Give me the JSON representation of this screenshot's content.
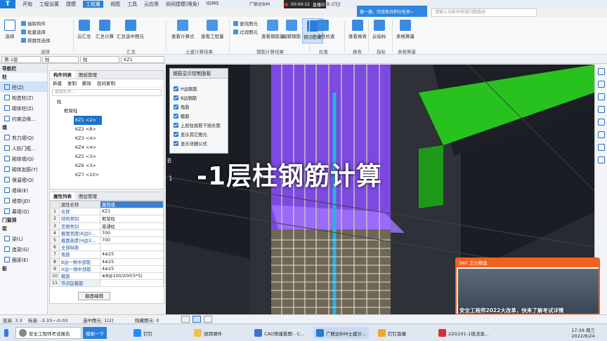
{
  "titlebar": {
    "logo": "T",
    "menus": [
      "开始",
      "工程设置",
      "建模",
      "工程量",
      "视图",
      "工具",
      "云应用",
      "协同建模(限免)",
      "IGMS"
    ],
    "active_menu": "工程量",
    "app_title": "广联达BIM",
    "file_path": ":\\商业.GTJ]",
    "rec_time": "00:04:12",
    "rec_status": "直播中",
    "notice": "搜一搜，完成每日积分任务~",
    "search_placeholder": "请输入功能名称或问题描述"
  },
  "ribbon": {
    "select": [
      "选择"
    ],
    "select_small": [
      "抽取构件",
      "批量选择",
      "按属性选择"
    ],
    "group_select": "选择",
    "summary": [
      "云汇总",
      "汇总计算",
      "汇总选中图元"
    ],
    "group_summary": "汇总",
    "civil": [
      "查看计算式",
      "查看工程量"
    ],
    "group_civil": "土建计算结果",
    "rebar_small": [
      "查找图元",
      "过滤图元"
    ],
    "rebar": [
      "查看钢筋量",
      "编辑钢筋",
      "钢筋三维"
    ],
    "group_rebar": "钢筋计算结果",
    "check": [
      "合法性检查"
    ],
    "group_check": "检查",
    "report": [
      "查看报表"
    ],
    "group_report": "报表",
    "index": [
      "云指标"
    ],
    "group_index": "指标",
    "table": [
      "表格算量"
    ],
    "group_table": "表格算量"
  },
  "selectors": [
    "第-1层",
    "柱",
    "柱",
    "KZ1"
  ],
  "nav": {
    "header": "导航栏",
    "sec_col": "柱",
    "col_items": [
      "柱(Z)",
      "构造柱(Z)",
      "砌体柱(Z)",
      "约束边缘..."
    ],
    "sec_wall": "墙",
    "wall_items": [
      "剪力墙(Q)",
      "人防门框...",
      "砌体墙(Q)",
      "砌体加筋(Y)",
      "保温墙(Q)",
      "墙垛(E)",
      "墙带(JD)",
      "幕墙(Q)"
    ],
    "sec_door": "门窗洞",
    "sec_beam": "梁",
    "beam_items": [
      "梁(L)",
      "连梁(G)",
      "圈梁(E)"
    ],
    "sec_slab": "板"
  },
  "component": {
    "tabs": [
      "构件列表",
      "图纸管理"
    ],
    "toolbar": [
      "新建",
      "复制",
      "删除",
      "层间复制"
    ],
    "search_placeholder": "搜索构件...",
    "root": "柱",
    "group": "框架柱",
    "items": [
      "KZ1 <2>",
      "KZ2 <8>",
      "KZ3 <4>",
      "KZ4 <4>",
      "KZ5 <3>",
      "KZ6 <3>",
      "KZ7 <10>"
    ]
  },
  "props": {
    "tabs": [
      "属性列表",
      "图层管理"
    ],
    "header": [
      "属性名称",
      "属性值"
    ],
    "rows": [
      [
        "1",
        "名称",
        "KZ1"
      ],
      [
        "2",
        "结构类别",
        "框架柱"
      ],
      [
        "3",
        "定额类别",
        "普通柱"
      ],
      [
        "4",
        "截面宽度(B边)(...",
        "700"
      ],
      [
        "5",
        "截面高度(H边)(...",
        "700"
      ],
      [
        "6",
        "全部纵筋",
        ""
      ],
      [
        "7",
        "角筋",
        "4⊕25"
      ],
      [
        "8",
        "B边一侧中部筋",
        "4⊕25"
      ],
      [
        "9",
        "H边一侧中部筋",
        "4⊕25"
      ],
      [
        "10",
        "箍筋",
        "⊕8@100/200(5*5)"
      ],
      [
        "11",
        "节点区箍筋",
        ""
      ]
    ],
    "button": "截面编辑"
  },
  "rebar_panel": {
    "title": "钢筋显示控制面板",
    "options": [
      "H边钢筋",
      "B边钢筋",
      "角筋",
      "箍筋",
      "上层柱插筋下插长度",
      "显示其它图元",
      "显示详细公式"
    ]
  },
  "overlay_title": "-1层柱钢筋计算",
  "viewport_labels": [
    "B",
    "1"
  ],
  "status": {
    "floor_h": "层高: 3.3",
    "elevation": "标高: -3.33~-0.03",
    "selected": "选中图元: 1(2)",
    "hidden": "隐藏图元: 0"
  },
  "ad": {
    "header": "360 卫士精选",
    "caption": "安全工程师2022大改革，快来了解考试详情"
  },
  "taskbar": {
    "items": [
      "安全工程师考试报名",
      "搜索一下",
      "钉钉",
      "视频课件",
      "CAD快速看图 - C...",
      "广联达BIM土建计...",
      "钉钉直播",
      "22G101-1现浇混..."
    ],
    "time": "17:39 周三",
    "date": "2022/8/24"
  },
  "colors": {
    "accent": "#2b7fd9",
    "purple": "#8a4dff",
    "green": "#27c21e",
    "ad_orange": "#f1621e"
  }
}
